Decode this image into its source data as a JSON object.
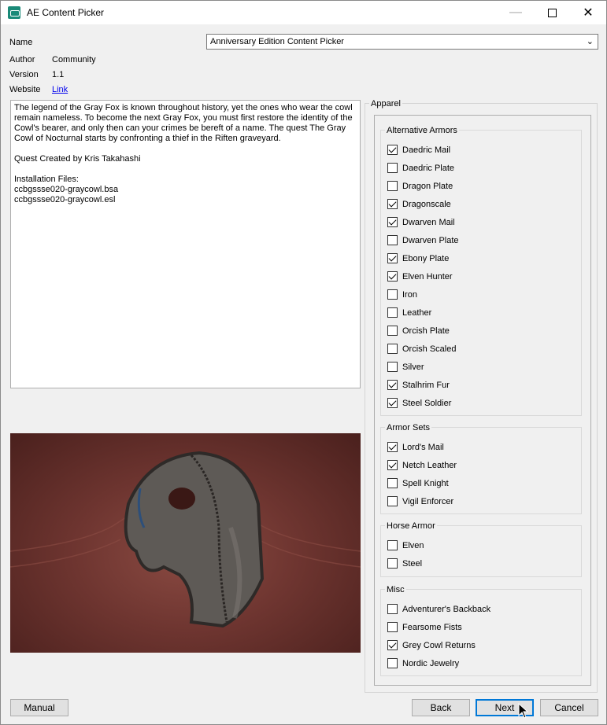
{
  "window": {
    "title": "AE Content Picker"
  },
  "info": {
    "name_label": "Name",
    "name_value": "Anniversary Edition Content Picker",
    "author_label": "Author",
    "author_value": "Community",
    "version_label": "Version",
    "version_value": "1.1",
    "website_label": "Website",
    "website_value": "Link"
  },
  "description": "The legend of the Gray Fox is known throughout history, yet the ones who wear the cowl remain nameless. To become the next Gray Fox, you must first restore the identity of the Cowl's bearer, and only then can your crimes be bereft of a name. The quest The Gray Cowl of Nocturnal starts by confronting a thief in the Riften graveyard.\n\nQuest Created by Kris Takahashi\n\nInstallation Files:\nccbgssse020-graycowl.bsa\nccbgssse020-graycowl.esl",
  "apparel": {
    "title": "Apparel",
    "groups": [
      {
        "title": "Alternative Armors",
        "items": [
          {
            "label": "Daedric Mail",
            "checked": true
          },
          {
            "label": "Daedric Plate",
            "checked": false
          },
          {
            "label": "Dragon Plate",
            "checked": false
          },
          {
            "label": "Dragonscale",
            "checked": true
          },
          {
            "label": "Dwarven Mail",
            "checked": true
          },
          {
            "label": "Dwarven Plate",
            "checked": false
          },
          {
            "label": "Ebony Plate",
            "checked": true
          },
          {
            "label": "Elven Hunter",
            "checked": true
          },
          {
            "label": "Iron",
            "checked": false
          },
          {
            "label": "Leather",
            "checked": false
          },
          {
            "label": "Orcish Plate",
            "checked": false
          },
          {
            "label": "Orcish Scaled",
            "checked": false
          },
          {
            "label": "Silver",
            "checked": false
          },
          {
            "label": "Stalhrim Fur",
            "checked": true
          },
          {
            "label": "Steel Soldier",
            "checked": true
          }
        ]
      },
      {
        "title": "Armor Sets",
        "items": [
          {
            "label": "Lord's Mail",
            "checked": true
          },
          {
            "label": "Netch Leather",
            "checked": true
          },
          {
            "label": "Spell Knight",
            "checked": false
          },
          {
            "label": "Vigil Enforcer",
            "checked": false
          }
        ]
      },
      {
        "title": "Horse Armor",
        "items": [
          {
            "label": "Elven",
            "checked": false
          },
          {
            "label": "Steel",
            "checked": false
          }
        ]
      },
      {
        "title": "Misc",
        "items": [
          {
            "label": "Adventurer's Backback",
            "checked": false
          },
          {
            "label": "Fearsome Fists",
            "checked": false
          },
          {
            "label": "Grey Cowl Returns",
            "checked": true
          },
          {
            "label": "Nordic Jewelry",
            "checked": false
          }
        ]
      }
    ]
  },
  "buttons": {
    "manual": "Manual",
    "back": "Back",
    "next": "Next",
    "cancel": "Cancel"
  }
}
